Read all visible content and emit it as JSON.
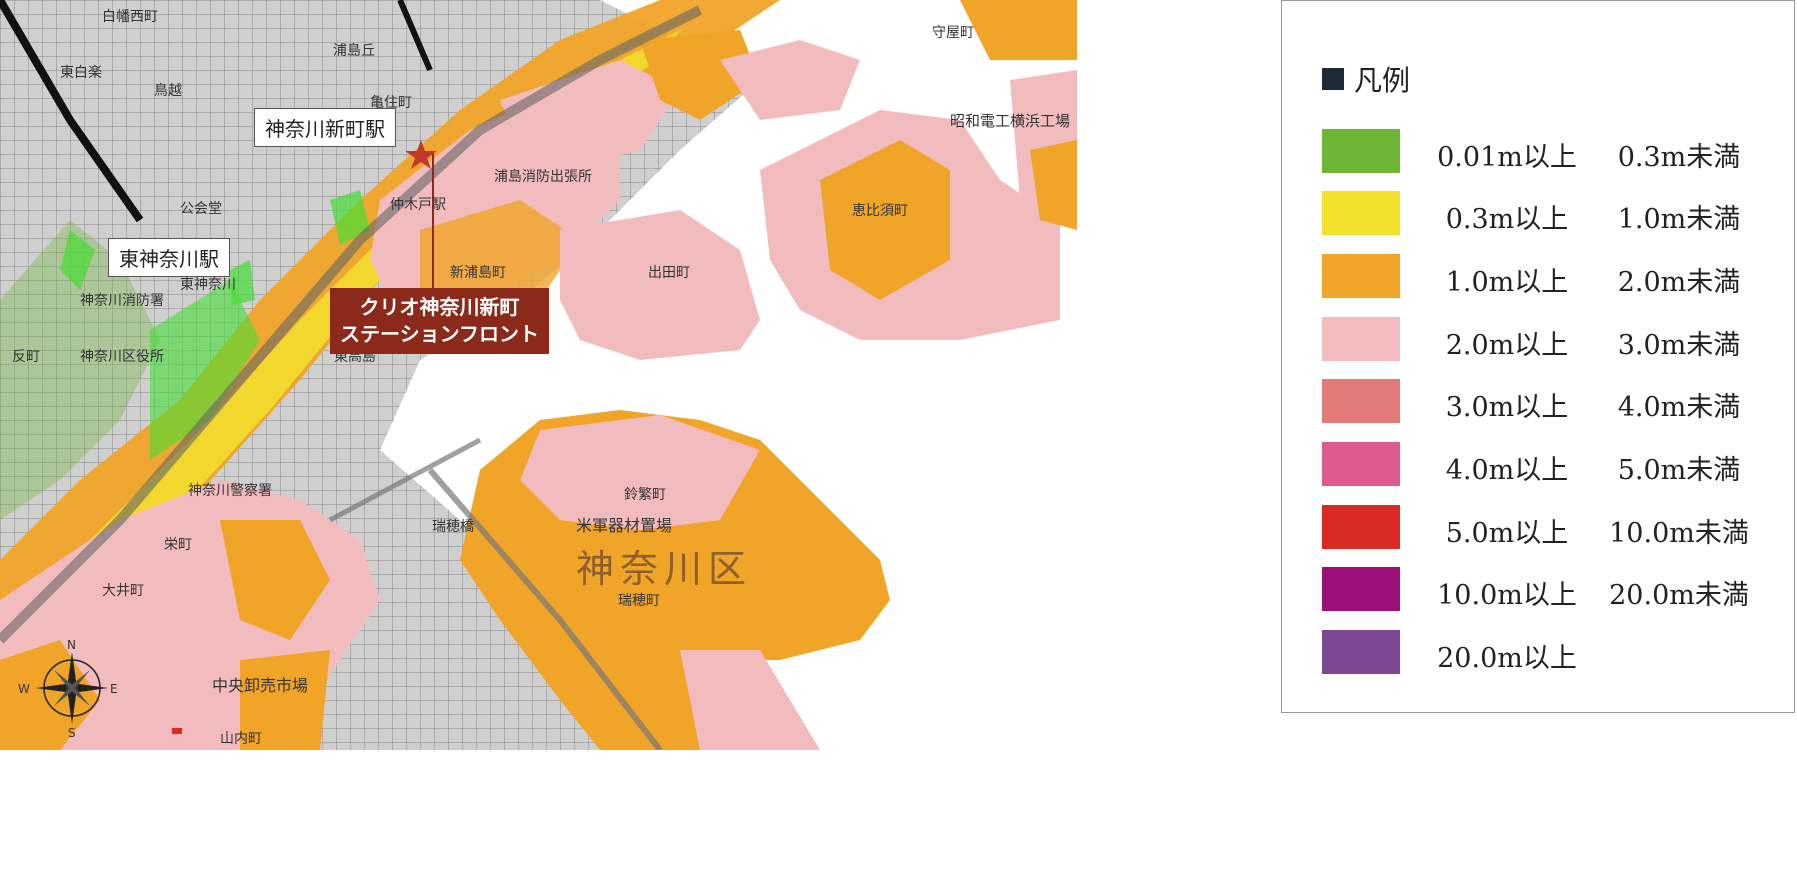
{
  "map": {
    "stations": {
      "kanagawa_shinmachi": "神奈川新町駅",
      "higashi_kanagawa": "東神奈川駅"
    },
    "property": {
      "line1": "クリオ神奈川新町",
      "line2": "ステーションフロント"
    },
    "ward": "神奈川区",
    "places": [
      "白幡西町",
      "浦島丘",
      "東白楽",
      "鳥越",
      "亀住町",
      "守屋町",
      "浦島消防出張所",
      "公会堂",
      "神奈川消防署",
      "神奈川区役所",
      "東神奈川",
      "新浦島町",
      "出田町",
      "東高島",
      "神奈川警察署",
      "鈴繁町",
      "米軍器材置場",
      "瑞穂町",
      "瑞穂橋",
      "中央卸売市場",
      "山内町",
      "栄町",
      "昭和電工横浜工場",
      "恵比須町",
      "仲木戸駅",
      "大井町",
      "反町"
    ],
    "compass": {
      "n": "N",
      "s": "S",
      "e": "E",
      "w": "W"
    }
  },
  "legend": {
    "title": "凡例",
    "items": [
      {
        "color": "#6cb535",
        "lo": "0.01m以上",
        "hi": "0.3m未満"
      },
      {
        "color": "#f2e02b",
        "lo": "0.3m以上",
        "hi": "1.0m未満"
      },
      {
        "color": "#f0a428",
        "lo": "1.0m以上",
        "hi": "2.0m未満"
      },
      {
        "color": "#f2bcbe",
        "lo": "2.0m以上",
        "hi": "3.0m未満"
      },
      {
        "color": "#e37a7a",
        "lo": "3.0m以上",
        "hi": "4.0m未満"
      },
      {
        "color": "#dc5a90",
        "lo": "4.0m以上",
        "hi": "5.0m未満"
      },
      {
        "color": "#d92b24",
        "lo": "5.0m以上",
        "hi": "10.0m未満"
      },
      {
        "color": "#9b0f7a",
        "lo": "10.0m以上",
        "hi": "20.0m未満"
      },
      {
        "color": "#7e4794",
        "lo": "20.0m以上",
        "hi": ""
      }
    ]
  },
  "colors": {
    "property_box": "#8b2a1a",
    "star": "#c0392b",
    "water": "#ffffff",
    "urban": "#d9d9d9"
  }
}
